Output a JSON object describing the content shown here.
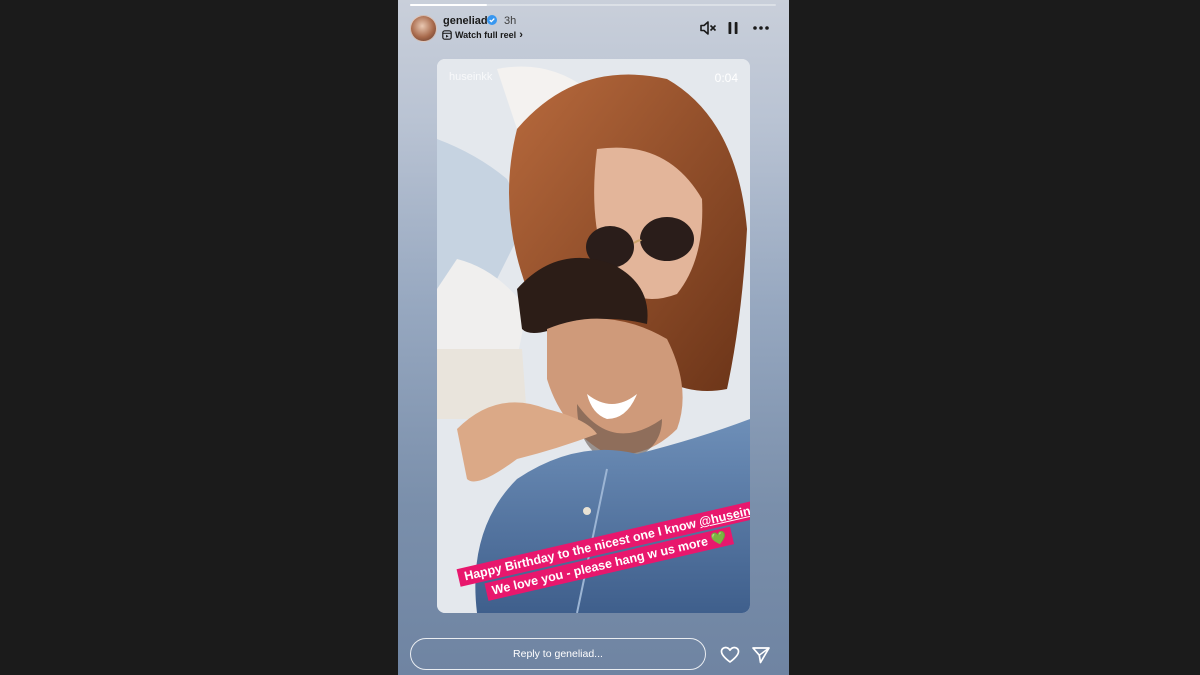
{
  "story": {
    "progress": 0.21,
    "username": "geneliad",
    "time_ago": "3h",
    "watch_reel_label": "Watch full reel",
    "reel_owner_watermark": "huseinkk",
    "duration": "0:04",
    "caption": {
      "line1_prefix": "Happy Birthday to the nicest one I know ",
      "line1_mention": "@huseinkk",
      "line2": "We love you - please hang w us more",
      "emoji": "💚"
    },
    "reply_placeholder": "Reply to geneliad..."
  },
  "icons": {
    "mute": "speaker-muted-icon",
    "pause": "pause-icon",
    "more": "more-options-icon",
    "like": "heart-icon",
    "share": "send-icon",
    "verified": "verified-badge-icon",
    "reel": "reel-icon"
  },
  "colors": {
    "caption_bg": "#e8176d",
    "page_bg": "#1b1b1b"
  }
}
